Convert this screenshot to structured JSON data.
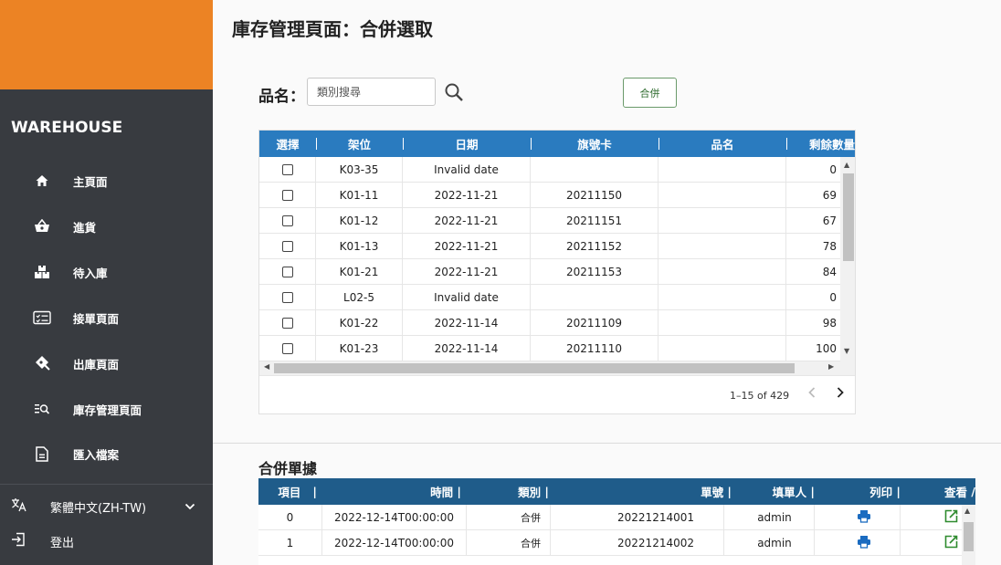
{
  "sidebar": {
    "brand": "WAREHOUSE",
    "items": [
      {
        "label": "主頁面",
        "icon": "home-icon"
      },
      {
        "label": "進貨",
        "icon": "basket-icon"
      },
      {
        "label": "待入庫",
        "icon": "boxes-icon"
      },
      {
        "label": "接單頁面",
        "icon": "form-list-icon"
      },
      {
        "label": "出庫頁面",
        "icon": "shipping-icon"
      },
      {
        "label": "庫存管理頁面",
        "icon": "inventory-search-icon"
      },
      {
        "label": "匯入檔案",
        "icon": "document-icon"
      }
    ],
    "language": {
      "label": "繁體中文(ZH-TW)",
      "icon": "translate-icon"
    },
    "logout": {
      "label": "登出",
      "icon": "logout-icon"
    },
    "colors": {
      "sidebar_bg": "#383b40",
      "brand_bar": "#ec8324"
    }
  },
  "main": {
    "title": "庫存管理頁面：合併選取",
    "filter_label": "品名：",
    "search": {
      "placeholder": "類別搜尋",
      "value": "",
      "icon": "search-icon"
    },
    "merge_button": "合併"
  },
  "stock_table": {
    "header_color": "#2a7bbf",
    "columns": [
      "選擇",
      "架位",
      "日期",
      "旗號卡",
      "品名",
      "剩餘數量"
    ],
    "rows": [
      {
        "checked": false,
        "shelf": "K03-35",
        "date": "Invalid date",
        "flag": "",
        "name": "",
        "qty": "0"
      },
      {
        "checked": false,
        "shelf": "K01-11",
        "date": "2022-11-21",
        "flag": "20211150",
        "name": "",
        "qty": "69"
      },
      {
        "checked": false,
        "shelf": "K01-12",
        "date": "2022-11-21",
        "flag": "20211151",
        "name": "",
        "qty": "67"
      },
      {
        "checked": false,
        "shelf": "K01-13",
        "date": "2022-11-21",
        "flag": "20211152",
        "name": "",
        "qty": "78"
      },
      {
        "checked": false,
        "shelf": "K01-21",
        "date": "2022-11-21",
        "flag": "20211153",
        "name": "",
        "qty": "84"
      },
      {
        "checked": false,
        "shelf": "L02-5",
        "date": "Invalid date",
        "flag": "",
        "name": "",
        "qty": "0"
      },
      {
        "checked": false,
        "shelf": "K01-22",
        "date": "2022-11-14",
        "flag": "20211109",
        "name": "",
        "qty": "98"
      },
      {
        "checked": false,
        "shelf": "K01-23",
        "date": "2022-11-14",
        "flag": "20211110",
        "name": "",
        "qty": "100"
      }
    ],
    "pagination": {
      "info": "1–15 of 429"
    }
  },
  "merge_section": {
    "title": "合併單據",
    "header_color": "#1f5c8a",
    "columns": [
      "項目",
      "時間",
      "類別",
      "單號",
      "填單人",
      "列印",
      "查看"
    ],
    "rows": [
      {
        "index": "0",
        "time": "2022-12-14T00:00:00",
        "type": "合併",
        "number": "20221214001",
        "user": "admin"
      },
      {
        "index": "1",
        "time": "2022-12-14T00:00:00",
        "type": "合併",
        "number": "20221214002",
        "user": "admin"
      }
    ]
  }
}
